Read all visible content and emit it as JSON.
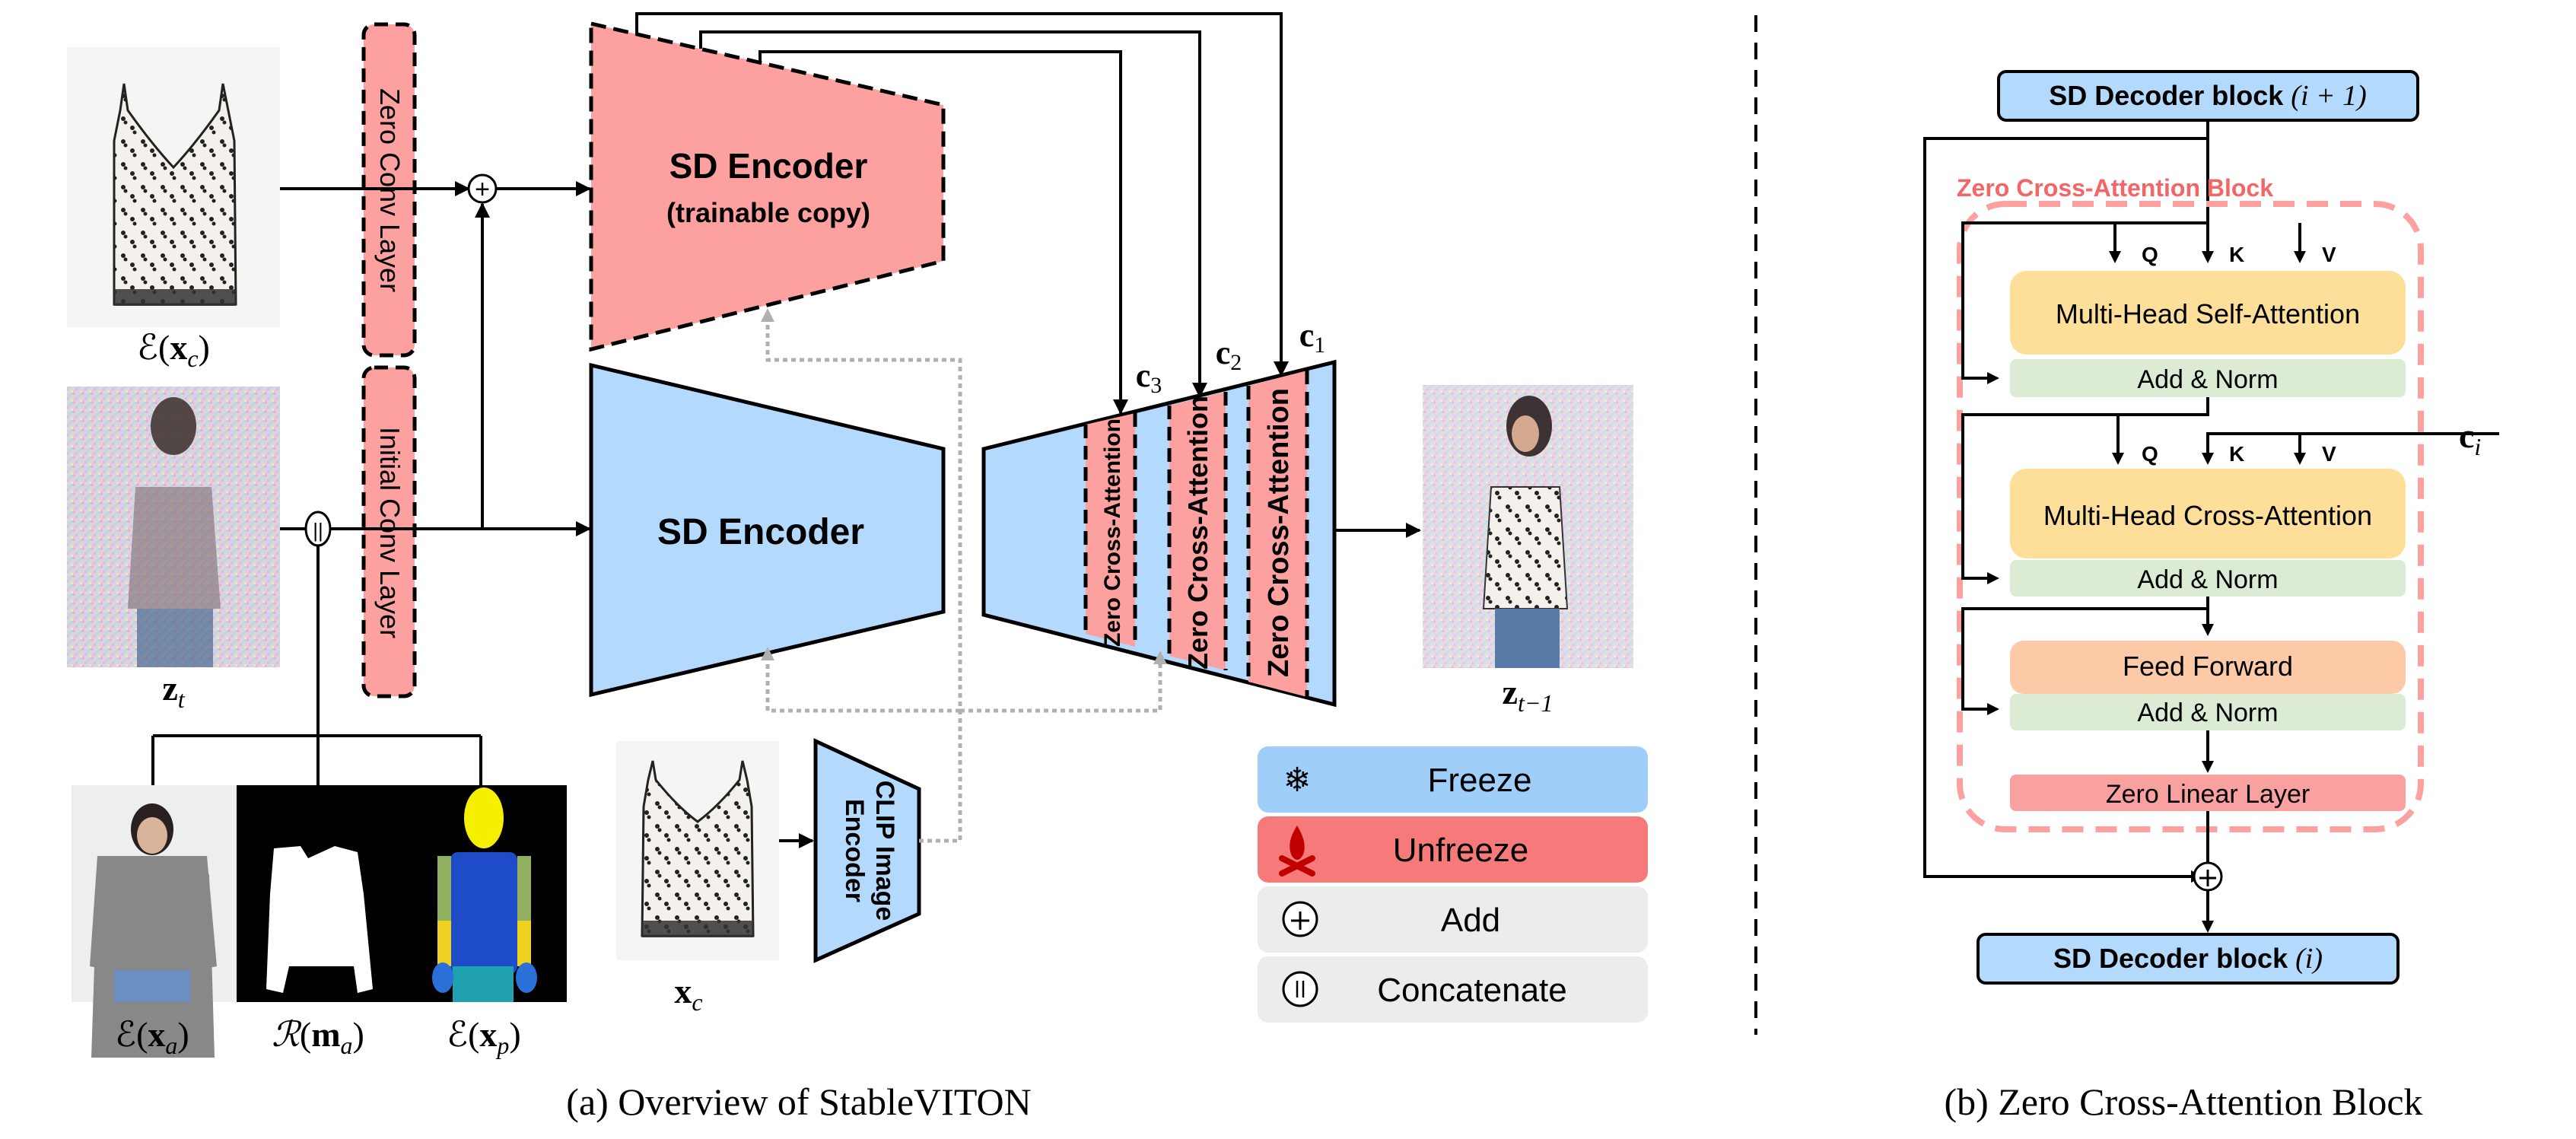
{
  "figure": {
    "captions": {
      "a": "(a) Overview of StableVITON",
      "b": "(b) Zero Cross-Attention Block"
    }
  },
  "overview": {
    "inputs": {
      "garment_latent": {
        "label_fn": "ℰ",
        "label_var": "x",
        "label_sub": "c"
      },
      "noisy_latent": {
        "label_var": "z",
        "label_sub": "t"
      },
      "agnostic_latent": {
        "label_fn": "ℰ",
        "label_var": "x",
        "label_sub": "a"
      },
      "mask_resized": {
        "label_fn": "ℛ",
        "label_var": "m",
        "label_sub": "a"
      },
      "pose_latent": {
        "label_fn": "ℰ",
        "label_var": "x",
        "label_sub": "p"
      },
      "garment_image": {
        "label_var": "x",
        "label_sub": "c"
      }
    },
    "blocks": {
      "zero_conv": "Zero Conv Layer",
      "initial_conv": "Initial Conv Layer",
      "trainable_encoder_title": "SD Encoder",
      "trainable_encoder_subtitle": "(trainable copy)",
      "sd_encoder": "SD Encoder",
      "clip_line1": "CLIP Image",
      "clip_line2": "Encoder",
      "zero_cross_attention": [
        "Zero Cross-Attention",
        "Zero Cross-Attention",
        "Zero Cross-Attention"
      ]
    },
    "condition_labels": [
      {
        "var": "c",
        "sub": "3"
      },
      {
        "var": "c",
        "sub": "2"
      },
      {
        "var": "c",
        "sub": "1"
      }
    ],
    "output": {
      "label_var": "z",
      "label_sub": "t−1"
    },
    "operators": {
      "add": "+",
      "concat": "||"
    },
    "legend": [
      {
        "icon": "snowflake-icon",
        "label": "Freeze",
        "color": "#9fcff9"
      },
      {
        "icon": "campfire-icon",
        "label": "Unfreeze",
        "color": "#f77a7a"
      },
      {
        "icon": "add-circle-icon",
        "label": "Add",
        "color": "#ececec"
      },
      {
        "icon": "concat-circle-icon",
        "label": "Concatenate",
        "color": "#ececec"
      }
    ]
  },
  "zero_cross_attention_block": {
    "title": "Zero Cross-Attention Block",
    "decoder_in": {
      "text": "SD Decoder block",
      "math": "(i + 1)"
    },
    "decoder_out": {
      "text": "SD Decoder block",
      "math": "(i)"
    },
    "qkv": [
      "Q",
      "K",
      "V"
    ],
    "self_attention": "Multi-Head Self-Attention",
    "cross_attention": "Multi-Head Cross-Attention",
    "add_norm": "Add & Norm",
    "feed_forward": "Feed Forward",
    "zero_linear": "Zero Linear Layer",
    "condition": {
      "var": "c",
      "sub": "i"
    }
  },
  "colors": {
    "frozen_blue": "#b3dafd",
    "trainable_pink": "#fca0a0",
    "attention_yellow": "#fddf9a",
    "add_norm_green": "#dcebd3",
    "feed_forward_orange": "#fdcaa7",
    "zero_linear_red": "#f9a0a0",
    "block_border_pink": "#fca0a0",
    "block_title_red": "#f46565",
    "dotted_gray": "#b0b0b0"
  }
}
